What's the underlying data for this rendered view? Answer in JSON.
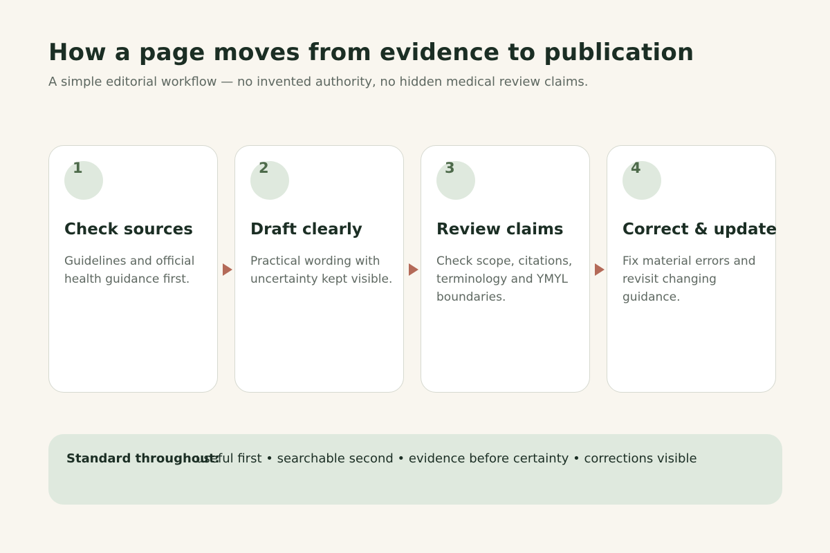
{
  "header": {
    "title": "How a page moves from evidence to publication",
    "subtitle": "A simple editorial workflow — no invented authority, no hidden medical review claims."
  },
  "steps": [
    {
      "number": "1",
      "title": "Check sources",
      "description": "Guidelines and official health guidance first."
    },
    {
      "number": "2",
      "title": "Draft clearly",
      "description": "Practical wording with uncertainty kept visible."
    },
    {
      "number": "3",
      "title": "Review claims",
      "description": "Check scope, citations, terminology and YMYL boundaries."
    },
    {
      "number": "4",
      "title": "Correct & update",
      "description": "Fix material errors and revisit changing guidance."
    }
  ],
  "banner": {
    "label": "Standard throughout:",
    "text": "useful first • searchable second • evidence before certainty • corrections visible"
  },
  "colors": {
    "background": "#f9f6ef",
    "heading": "#1b2e24",
    "accent_green": "#4d6a4a",
    "soft_green": "#dfe9de",
    "arrow": "#b46a58"
  }
}
